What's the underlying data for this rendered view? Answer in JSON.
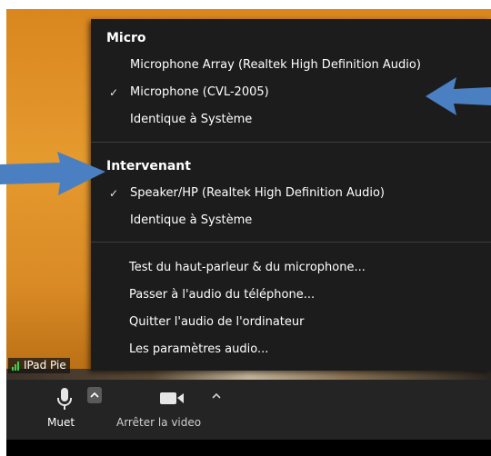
{
  "participant": {
    "name_label": "IPad Pie"
  },
  "audio_menu": {
    "microphone_section": {
      "title": "Micro",
      "items": [
        {
          "label": "Microphone Array (Realtek High Definition Audio)",
          "selected": false
        },
        {
          "label": "Microphone (CVL-2005)",
          "selected": true
        },
        {
          "label": "Identique à Système",
          "selected": false
        }
      ]
    },
    "speaker_section": {
      "title": "Intervenant",
      "items": [
        {
          "label": "Speaker/HP (Realtek High Definition Audio)",
          "selected": true
        },
        {
          "label": "Identique à Système",
          "selected": false
        }
      ]
    },
    "commands": [
      "Test du haut-parleur & du microphone...",
      "Passer à l'audio du téléphone...",
      "Quitter l'audio de l'ordinateur",
      "Les paramètres audio..."
    ],
    "check_glyph": "✓"
  },
  "toolbar": {
    "mute_label": "Muet",
    "video_label": "Arrêter la video"
  },
  "colors": {
    "menu_bg": "#1c1c1c",
    "toolbar_bg": "#242424",
    "annotation_arrow": "#4a7fc1",
    "video_bg": "#e08f28",
    "signal_green": "#3ecf4f"
  },
  "icons": [
    "microphone-icon",
    "video-camera-icon",
    "chevron-up-icon",
    "check-icon",
    "signal-bars-icon"
  ]
}
